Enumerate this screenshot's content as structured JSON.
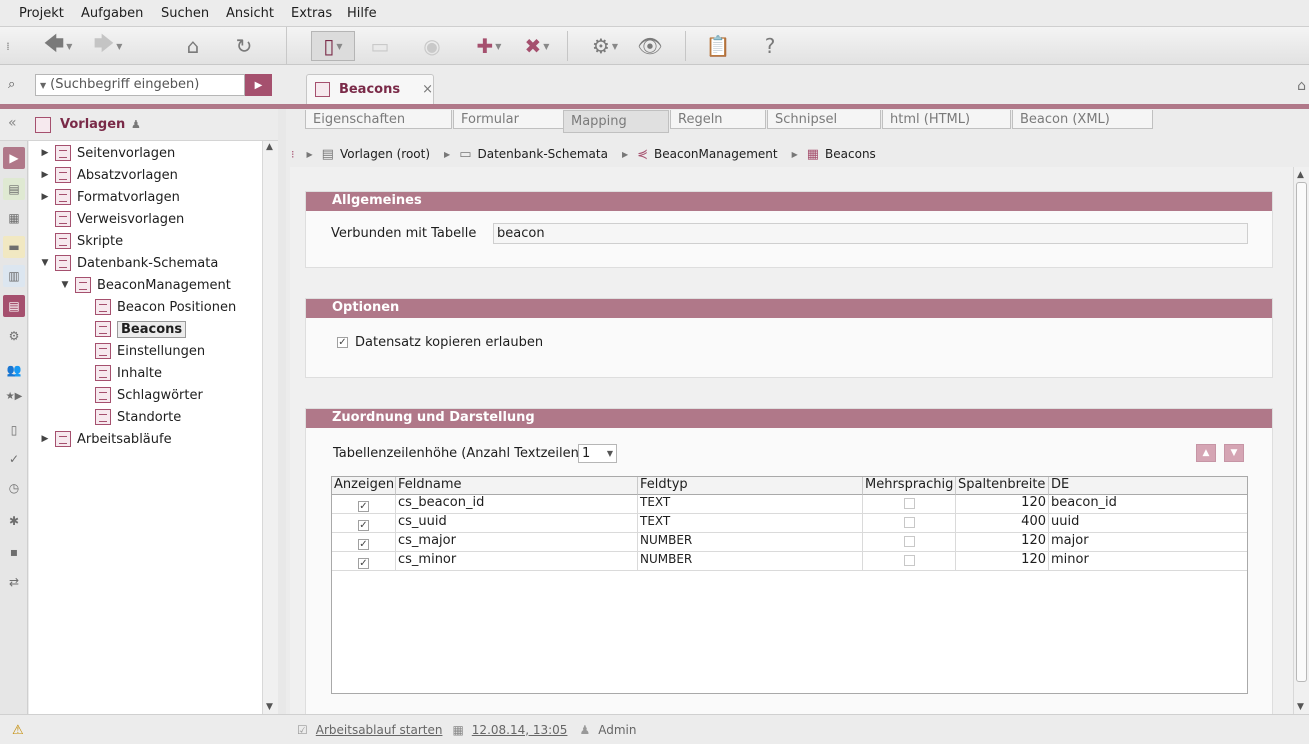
{
  "menu": [
    "Projekt",
    "Aufgaben",
    "Suchen",
    "Ansicht",
    "Extras",
    "Hilfe"
  ],
  "search": {
    "placeholder": "(Suchbegriff eingeben)"
  },
  "sidebar": {
    "title": "Vorlagen",
    "tree": [
      {
        "label": "Seitenvorlagen"
      },
      {
        "label": "Absatzvorlagen"
      },
      {
        "label": "Formatvorlagen"
      },
      {
        "label": "Verweisvorlagen"
      },
      {
        "label": "Skripte"
      },
      {
        "label": "Datenbank-Schemata"
      },
      {
        "label": "BeaconManagement"
      },
      {
        "label": "Beacon Positionen"
      },
      {
        "label": "Beacons"
      },
      {
        "label": "Einstellungen"
      },
      {
        "label": "Inhalte"
      },
      {
        "label": "Schlagwörter"
      },
      {
        "label": "Standorte"
      },
      {
        "label": "Arbeitsabläufe"
      }
    ]
  },
  "doc_tab": {
    "label": "Beacons"
  },
  "subtabs": [
    "Eigenschaften",
    "Formular",
    "Mapping",
    "Regeln",
    "Schnipsel",
    "html (HTML)",
    "Beacon (XML)"
  ],
  "breadcrumb": [
    "Vorlagen (root)",
    "Datenbank-Schemata",
    "BeaconManagement",
    "Beacons"
  ],
  "general": {
    "title": "Allgemeines",
    "table_label": "Verbunden mit Tabelle",
    "table_value": "beacon"
  },
  "options": {
    "title": "Optionen",
    "copy_label": "Datensatz kopieren erlauben"
  },
  "mapping": {
    "title": "Zuordnung und Darstellung",
    "row_height_label": "Tabellenzeilenhöhe (Anzahl Textzeilen)",
    "row_height_value": "1",
    "columns": [
      "Anzeigen",
      "Feldname",
      "Feldtyp",
      "Mehrsprachig",
      "Spaltenbreite",
      "DE"
    ],
    "rows": [
      {
        "show": true,
        "field": "cs_beacon_id",
        "type": "TEXT",
        "multilang": false,
        "width": "120",
        "de": "beacon_id"
      },
      {
        "show": true,
        "field": "cs_uuid",
        "type": "TEXT",
        "multilang": false,
        "width": "400",
        "de": "uuid"
      },
      {
        "show": true,
        "field": "cs_major",
        "type": "NUMBER",
        "multilang": false,
        "width": "120",
        "de": "major"
      },
      {
        "show": true,
        "field": "cs_minor",
        "type": "NUMBER",
        "multilang": false,
        "width": "120",
        "de": "minor"
      }
    ]
  },
  "status": {
    "workflow_link": "Arbeitsablauf starten",
    "date": "12.08.14, 13:05",
    "user": "Admin"
  },
  "colors": {
    "accent": "#b07889",
    "accent_dark": "#a5506e"
  }
}
